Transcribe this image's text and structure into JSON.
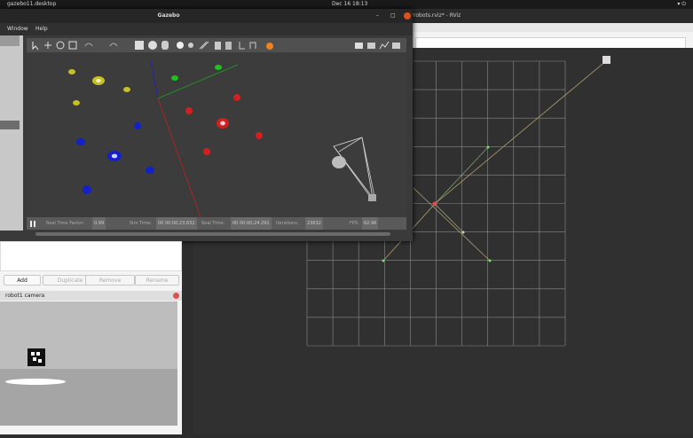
{
  "topbar": {
    "activities": "gazebo11.desktop",
    "datetime": "Dec 16  18:13"
  },
  "rviz": {
    "title": "/robots.rviz* - RViz"
  },
  "gazebo": {
    "title": "Gazebo",
    "menu": [
      "Window",
      "Help"
    ],
    "status": {
      "rtf_label": "Real Time Factor:",
      "rtf_value": "0.99",
      "sim_label": "Sim Time:",
      "sim_value": "00 00:00:23.632",
      "real_label": "Real Time:",
      "real_value": "00 00:00:24.291",
      "iter_label": "Iterations:",
      "iter_value": "23632",
      "fps_label": "FPS:",
      "fps_value": "62.96"
    }
  },
  "panel": {
    "buttons": [
      "Add",
      "Duplicate",
      "Remove",
      "Rename"
    ]
  },
  "camera": {
    "title": "robot1 camera"
  },
  "colors": {
    "red": "#d02020",
    "blue": "#1420c8",
    "yellow": "#c8c020",
    "green": "#20c020",
    "grid": "#8a8a8a"
  }
}
